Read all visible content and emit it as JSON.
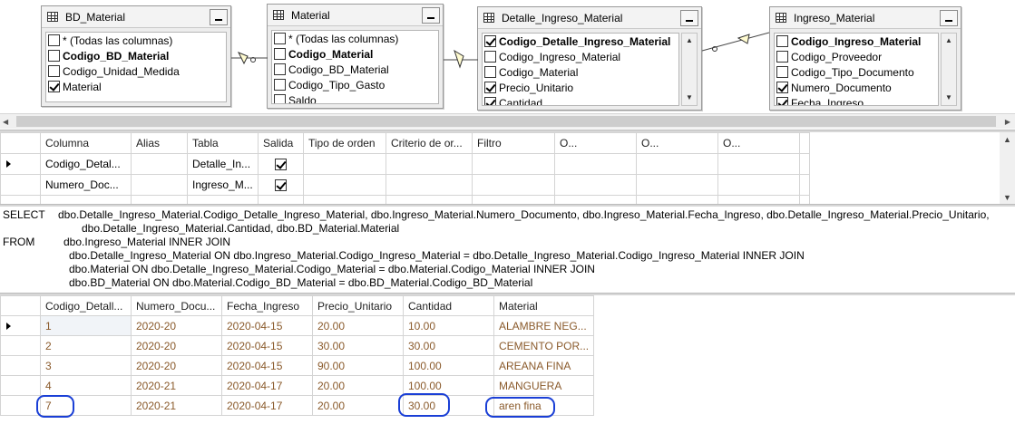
{
  "tables": [
    {
      "title": "BD_Material",
      "scroll": false,
      "columns": [
        {
          "label": "* (Todas las columnas)",
          "checked": false,
          "bold": false
        },
        {
          "label": "Codigo_BD_Material",
          "checked": false,
          "bold": true
        },
        {
          "label": "Codigo_Unidad_Medida",
          "checked": false,
          "bold": false
        },
        {
          "label": "Material",
          "checked": true,
          "bold": false
        }
      ]
    },
    {
      "title": "Material",
      "scroll": false,
      "columns": [
        {
          "label": "* (Todas las columnas)",
          "checked": false,
          "bold": false
        },
        {
          "label": "Codigo_Material",
          "checked": false,
          "bold": true
        },
        {
          "label": "Codigo_BD_Material",
          "checked": false,
          "bold": false
        },
        {
          "label": "Codigo_Tipo_Gasto",
          "checked": false,
          "bold": false
        },
        {
          "label": "Saldo",
          "checked": false,
          "bold": false
        }
      ]
    },
    {
      "title": "Detalle_Ingreso_Material",
      "scroll": true,
      "columns": [
        {
          "label": "Codigo_Detalle_Ingreso_Material",
          "checked": true,
          "bold": true
        },
        {
          "label": "Codigo_Ingreso_Material",
          "checked": false,
          "bold": false
        },
        {
          "label": "Codigo_Material",
          "checked": false,
          "bold": false
        },
        {
          "label": "Precio_Unitario",
          "checked": true,
          "bold": false
        },
        {
          "label": "Cantidad",
          "checked": true,
          "bold": false
        }
      ]
    },
    {
      "title": "Ingreso_Material",
      "scroll": true,
      "columns": [
        {
          "label": "Codigo_Ingreso_Material",
          "checked": false,
          "bold": true
        },
        {
          "label": "Codigo_Proveedor",
          "checked": false,
          "bold": false
        },
        {
          "label": "Codigo_Tipo_Documento",
          "checked": false,
          "bold": false
        },
        {
          "label": "Numero_Documento",
          "checked": true,
          "bold": false
        },
        {
          "label": "Fecha_Ingreso",
          "checked": true,
          "bold": false
        }
      ]
    }
  ],
  "criteria": {
    "headers": [
      "Columna",
      "Alias",
      "Tabla",
      "Salida",
      "Tipo de orden",
      "Criterio de or...",
      "Filtro",
      "O...",
      "O...",
      "O..."
    ],
    "rows": [
      {
        "columna": "Codigo_Detal...",
        "alias": "",
        "tabla": "Detalle_In...",
        "salida": true,
        "current": true
      },
      {
        "columna": "Numero_Doc...",
        "alias": "",
        "tabla": "Ingreso_M...",
        "salida": true,
        "current": false
      }
    ]
  },
  "sql": {
    "lines": [
      {
        "keyword": "SELECT",
        "text": "dbo.Detalle_Ingreso_Material.Codigo_Detalle_Ingreso_Material, dbo.Ingreso_Material.Numero_Documento, dbo.Ingreso_Material.Fecha_Ingreso, dbo.Detalle_Ingreso_Material.Precio_Unitario,"
      },
      {
        "keyword": "",
        "text": "dbo.Detalle_Ingreso_Material.Cantidad, dbo.BD_Material.Material"
      },
      {
        "keyword": "FROM",
        "text": "dbo.Ingreso_Material INNER JOIN"
      },
      {
        "keyword": "",
        "text": "dbo.Detalle_Ingreso_Material ON dbo.Ingreso_Material.Codigo_Ingreso_Material = dbo.Detalle_Ingreso_Material.Codigo_Ingreso_Material INNER JOIN"
      },
      {
        "keyword": "",
        "text": "dbo.Material ON dbo.Detalle_Ingreso_Material.Codigo_Material = dbo.Material.Codigo_Material INNER JOIN"
      },
      {
        "keyword": "",
        "text": "dbo.BD_Material ON dbo.Material.Codigo_BD_Material = dbo.BD_Material.Codigo_BD_Material"
      }
    ]
  },
  "results": {
    "headers": [
      "Codigo_Detall...",
      "Numero_Docu...",
      "Fecha_Ingreso",
      "Precio_Unitario",
      "Cantidad",
      "Material"
    ],
    "rows": [
      [
        "1",
        "2020-20",
        "2020-04-15",
        "20.00",
        "10.00",
        "ALAMBRE NEG..."
      ],
      [
        "2",
        "2020-20",
        "2020-04-15",
        "30.00",
        "30.00",
        "CEMENTO POR..."
      ],
      [
        "3",
        "2020-20",
        "2020-04-15",
        "90.00",
        "100.00",
        "AREANA FINA"
      ],
      [
        "4",
        "2020-21",
        "2020-04-17",
        "20.00",
        "100.00",
        "MANGUERA"
      ],
      [
        "7",
        "2020-21",
        "2020-04-17",
        "20.00",
        "30.00",
        "aren fina"
      ]
    ]
  },
  "colors": {
    "annotation_ink": "#1a3fd6",
    "result_text": "#8a5a2b"
  }
}
